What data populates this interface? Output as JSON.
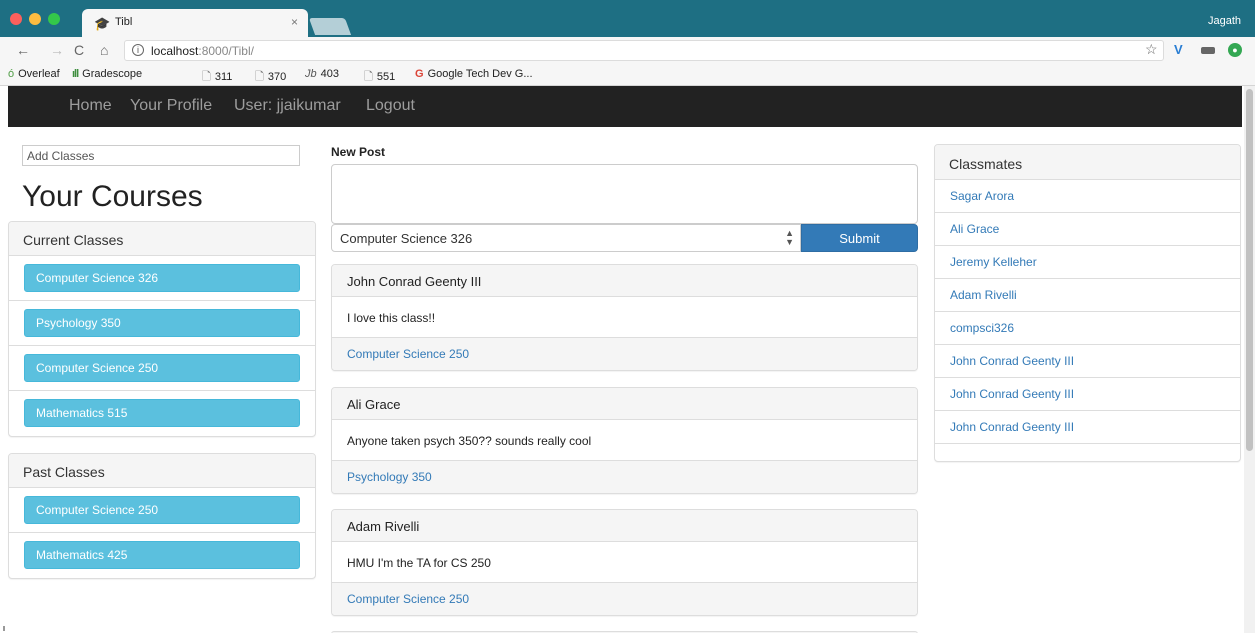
{
  "browser": {
    "tab_title": "Tibl",
    "tab_close": "×",
    "profile_name": "Jagath",
    "url_host": "localhost",
    "url_rest": ":8000/Tibl/",
    "nav_icons": {
      "back": "←",
      "forward": "→",
      "reload": "C",
      "home": "⌂",
      "info": "i",
      "star": "☆"
    },
    "bookmarks": [
      {
        "label": "Overleaf",
        "icon": "ó",
        "icon_name": "overleaf-icon"
      },
      {
        "label": "Gradescope",
        "icon": "ıll",
        "icon_name": "gradescope-icon"
      },
      {
        "label": "311",
        "icon": "🗋",
        "icon_name": "page-icon"
      },
      {
        "label": "370",
        "icon": "🗋",
        "icon_name": "page-icon"
      },
      {
        "label": "403",
        "icon": "Jb",
        "icon_name": "jb-icon"
      },
      {
        "label": "551",
        "icon": "🗋",
        "icon_name": "page-icon"
      },
      {
        "label": "Google Tech Dev G...",
        "icon": "G",
        "icon_name": "google-icon"
      }
    ]
  },
  "navbar": {
    "home": "Home",
    "profile": "Your Profile",
    "user": "User: jjaikumar",
    "logout": "Logout"
  },
  "left": {
    "add_classes_placeholder": "Add Classes",
    "courses_title": "Your Courses",
    "current_heading": "Current Classes",
    "current_classes": [
      "Computer Science 326",
      "Psychology 350",
      "Computer Science 250",
      "Mathematics 515"
    ],
    "past_heading": "Past Classes",
    "past_classes": [
      "Computer Science 250",
      "Mathematics 425"
    ]
  },
  "compose": {
    "label": "New Post",
    "selected_course": "Computer Science 326",
    "submit": "Submit"
  },
  "posts": [
    {
      "author": "John Conrad Geenty III",
      "body": "I love this class!!",
      "course": "Computer Science 250"
    },
    {
      "author": "Ali Grace",
      "body": "Anyone taken psych 350?? sounds really cool",
      "course": "Psychology 350"
    },
    {
      "author": "Adam Rivelli",
      "body": "HMU I'm the TA for CS 250",
      "course": "Computer Science 250"
    }
  ],
  "classmates": {
    "heading": "Classmates",
    "names": [
      "Sagar Arora",
      "Ali Grace",
      "Jeremy Kelleher",
      "Adam Rivelli",
      "compsci326",
      "John Conrad Geenty III",
      "John Conrad Geenty III",
      "John Conrad Geenty III"
    ]
  },
  "colors": {
    "tabbar": "#1e6f83",
    "navbar": "#222222",
    "info_button": "#5bc0de",
    "primary": "#337ab7",
    "link": "#337ab7"
  }
}
